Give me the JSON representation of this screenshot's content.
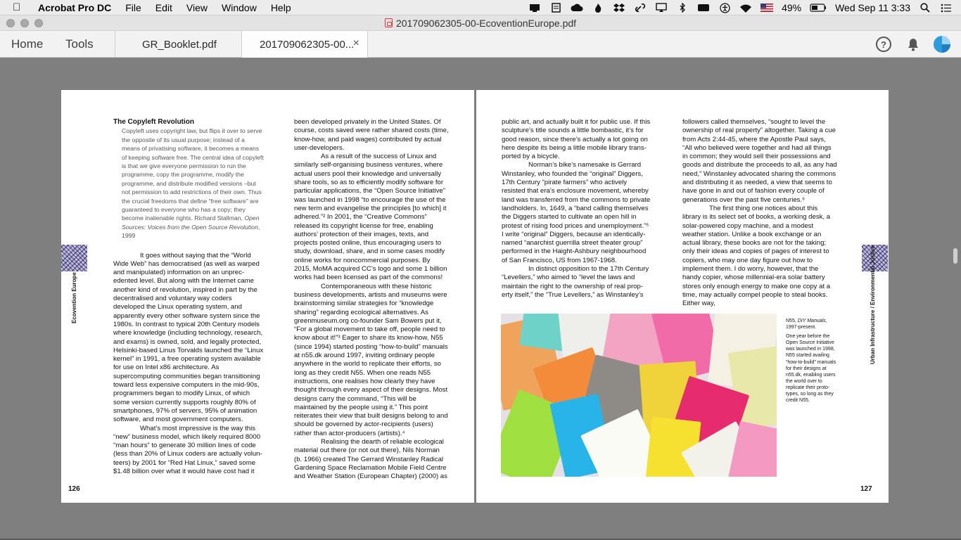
{
  "menubar": {
    "app_name": "Acrobat Pro DC",
    "menus": [
      "File",
      "Edit",
      "View",
      "Window",
      "Help"
    ],
    "battery": "49%",
    "datetime": "Wed Sep 11  3:33"
  },
  "window": {
    "title": "201709062305-00-EcoventionEurope.pdf"
  },
  "tabs": {
    "home": "Home",
    "tools": "Tools",
    "doc1": "GR_Booklet.pdf",
    "doc2": "201709062305-00...",
    "close_glyph": "×"
  },
  "left_page": {
    "heading": "The Copyleft Revolution",
    "quote": "Copyleft uses copyright law, but flips it over to serve the opposite of its usual purpose; instead of a means of privatising software, it becomes a means of keeping software free. The central idea of copyleft is that we give everyone permission to run the programme, copy the programme, modify the programme, and distribute modified versions –but not permission to add restrictions of their own. Thus the crucial freedoms that define “free soft­ware” are guaranteed to everyone who has a copy; they become inalienable rights. Richard Stallman,",
    "quote_source": "Open Sources: Voices from the Open Source Revolution",
    "quote_year": ", 1999",
    "col1_p1": "It goes without saying that the “World Wide Web” has democratised (as well as warped and manipulated) information on an unprec­edented level. But along with the Internet came another kind of revolution, inspired in part by the decentralised and voluntary way coders developed the Linux operating system, and apparently every other software system since the 1980s. In contrast to typical 20th Century models where knowledge (including technology, research, and exams) is owned, sold, and legally protected, Helsinki-based Linus Torvalds launched the “Linux kernel” in 1991, a free operating system available for use on Intel x86 architecture. As supercomputing communi­ties began transitioning toward less expensive computers in the mid-90s, programmers began to modify Linux, of which some version currently supports roughly 80% of smartphones, 97% of servers, 95% of animation software, and most government computers.",
    "col1_p2": "What’s most impressive is the way this “new” business model, which likely required 8000 “man hours” to generate 30 million lines of code (less than 20% of Linux coders are actually volun­teers) by 2001 for “Red Hat Linux,” saved some $1.48 billion over what it would have cost had it",
    "col2_p1": "been developed privately in the United States. Of course, costs saved were rather shared costs (time, know-how, and paid wages) contributed by actual user-developers.",
    "col2_p2": "As a result of the success of Linux and similarly self-organising business ventures, where actual users pool their knowledge and universally share tools, so as to efficiently modify software for particular applications, the “Open Source Initiative” was launched in 1998 “to encourage the use of the new term and evangelise the principles [to which] it adhered.”² In 2001, the “Creative Commons” released its copyright license for free, enabling authors’ protection of their images, texts, and projects posted online, thus encouraging users to study, download, share, and in some cases modify online works for noncommercial purposes. By 2015, MoMA acquired CC’s logo and some 1 billion works had been licensed as part of the commons!",
    "col2_p3": "Contemporaneous with these historic business developments, artists and museums were brainstorming similar strategies for “knowledge sharing” regarding ecological alternatives. As greenmuseum.org co-founder Sam Bowers put it, “For a global movement to take off, people need to know about it!”³ Eager to share its know-how, N55 (since 1994) started posting “how-to-build” manuals at n55.dk around 1997, inviting ordinary people anywhere in the world to replicate their efforts, so long as they credit N55. When one reads N55 instructions, one realises how clearly they have thought through every aspect of their designs. Most designs carry the command, “This will be maintained by the people using it.” This point reiterates their view that built designs belong to and should be governed by actor-recipients (users) rather than actor-producers (artists).⁴",
    "col2_p4": "Realising the dearth of reliable ecological material out there (or not out there), Nils Norman (b. 1966) created The Gerrard Winstanley Radical Gardening Space Reclamation Mobile Field Centre and Weather Station (European Chapter) (2000) as",
    "side_label": "Ecovention Europe",
    "page_number": "126"
  },
  "right_page": {
    "col1_p1": "public art, and actually built it for public use. If this sculpture’s title sounds a little bombastic, it’s for good reason, since there’s actually a lot going on here despite its being a little mobile library trans­ported by a bicycle.",
    "col1_p2": "Norman’s bike’s namesake is Gerrard Winstanley, who founded the “original” Diggers, 17th Century “pirate farmers” who actively resisted that era’s enclosure movement, whereby land was transferred from the commons to private land­holders. In, 1649, a “band calling themselves the Diggers started to cultivate an open hill in protest of rising food prices and unemployment.”⁵ I write “original” Diggers, because an identically-named “anarchist guerrilla street theater group” performed in the Haight-Ashbury neighbourhood of San Fran­cisco, US from 1967-1968.",
    "col1_p3": "In distinct opposition to the 17th Century “Levellers,” who aimed to “level the laws and maintain the right to the ownership of real prop­erty itself,” the “True Levellers,” as Winstanley’s",
    "col2_p1": "followers called themselves, “sought to level the ownership of real property” altogether. Taking a cue from Acts 2:44-45, where the Apostle Paul says, “All who believed were together and had all things in common; they would sell their posses­sions and goods and distribute the proceeds to all, as any had need,” Winstanley advocated sharing the commons and distributing it as needed, a view that seems to have gone in and out of fashion every couple of generations over the past five centuries.⁶",
    "col2_p2": "The first thing one notices about this library is its select set of books, a working desk, a solar-powered copy machine, and a modest weather station. Unlike a book exchange or an actual library, these books are not for the taking; only their ideas and copies of pages of interest to copiers, who may one day figure out how to implement them. I do worry, however, that the handy copier, whose millennial-era solar battery stores only enough energy to make one copy at a time, may actu­ally compel people to steal books. Either way,",
    "caption_title_a": "N55, ",
    "caption_title_b": "DIY Manuals",
    "caption_title_c": ", 1997-present.",
    "caption_body": "One year before the Open Source Initia­tive was launched in 1998, N55 started availing “how-to-build” manuals for their designs at n55.dk, enabling users the world over to replicate their proto­types, so long as they credit N55.",
    "side_label": "Urban Infrastructure / Environmental Justice",
    "page_number": "127"
  },
  "colors": {
    "doc_background": "#808080",
    "page": "#ffffff",
    "text": "#141414"
  }
}
